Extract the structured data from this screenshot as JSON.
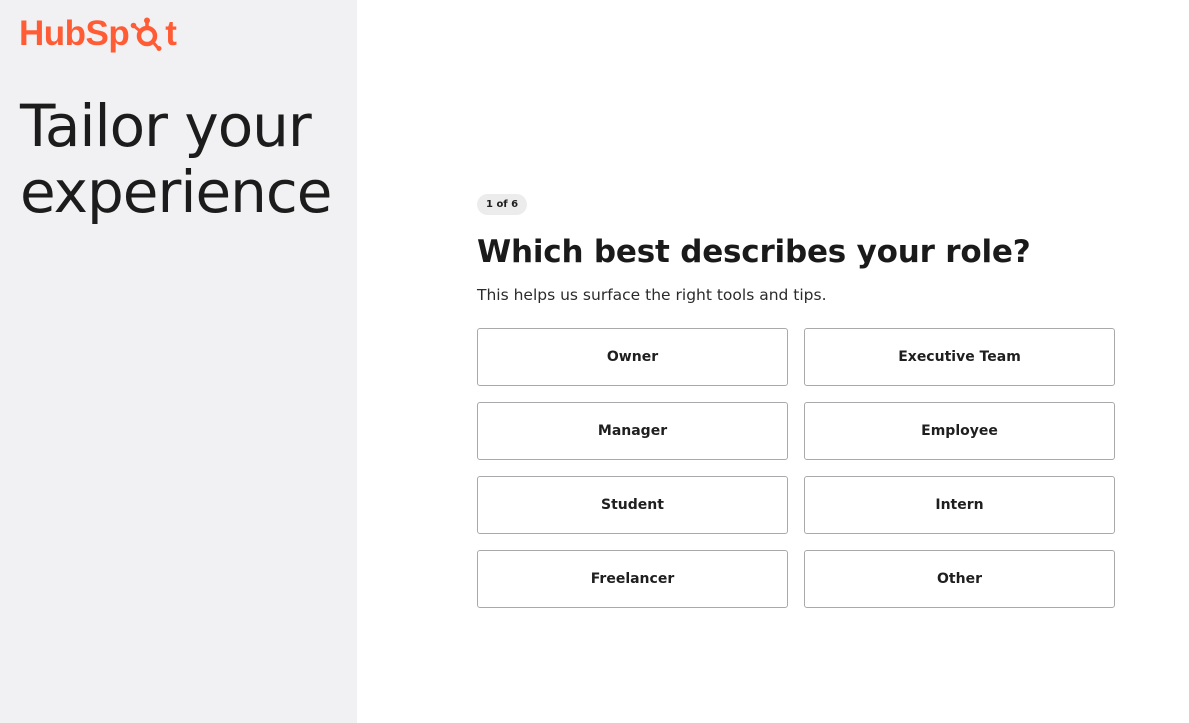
{
  "logo": {
    "text_before": "HubSp",
    "text_after": "t",
    "brand_color": "#ff5c35",
    "icon": "sprocket-icon"
  },
  "hero": {
    "title": "Tailor your experience"
  },
  "progress": {
    "label": "1 of 6",
    "current": 1,
    "total": 6
  },
  "question": {
    "title": "Which best describes your role?",
    "helper": "This helps us surface the right tools and tips."
  },
  "options": [
    "Owner",
    "Executive Team",
    "Manager",
    "Employee",
    "Student",
    "Intern",
    "Freelancer",
    "Other"
  ],
  "colors": {
    "left_panel_bg": "#f1f0f2",
    "option_border": "#a9a9ab",
    "badge_bg": "#ececec"
  }
}
